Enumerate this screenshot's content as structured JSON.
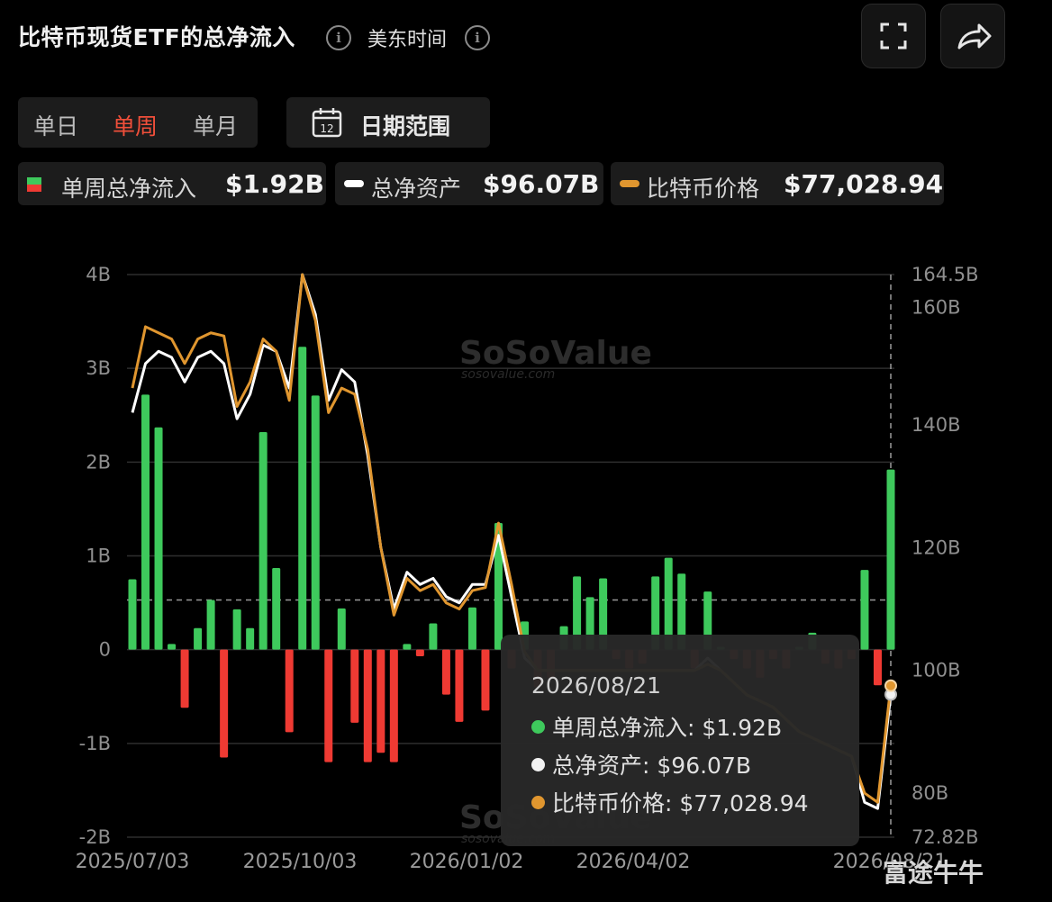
{
  "header": {
    "title": "比特币现货ETF的总净流入",
    "timezone": "美东时间"
  },
  "period_tabs": [
    {
      "label": "单日",
      "active": false
    },
    {
      "label": "单周",
      "active": true
    },
    {
      "label": "单月",
      "active": false
    }
  ],
  "date_range": {
    "label": "日期范围",
    "calendar_day": "12"
  },
  "legend": [
    {
      "label": "单周总净流入",
      "value": "$1.92B"
    },
    {
      "label": "总净资产",
      "value": "$96.07B"
    },
    {
      "label": "比特币价格",
      "value": "$77,028.94"
    }
  ],
  "tooltip": {
    "date": "2026/08/21",
    "rows": [
      {
        "label": "单周总净流入:",
        "value": "$1.92B",
        "color": "#3ec95c"
      },
      {
        "label": "总净资产:",
        "value": "$96.07B",
        "color": "#f2f2f2"
      },
      {
        "label": "比特币价格:",
        "value": "$77,028.94",
        "color": "#e0962f"
      }
    ]
  },
  "watermark": {
    "name": "SoSoValue",
    "url": "sosovalue.com"
  },
  "brand": "富途牛牛",
  "colors": {
    "inflow": "#3ec95c",
    "outflow": "#ef3a33",
    "assets": "#ffffff",
    "price": "#e0962f"
  },
  "chart_data": {
    "type": "bar",
    "ylim": [
      -2,
      4
    ],
    "y2lim": [
      72.82,
      164.5
    ],
    "left_ticks": [
      "-2B",
      "-1B",
      "0",
      "1B",
      "2B",
      "3B",
      "4B"
    ],
    "right_ticks": [
      "72.82B",
      "80B",
      "100B",
      "120B",
      "140B",
      "160B",
      "164.5B"
    ],
    "x_ticks": [
      "2025/07/03",
      "2025/10/03",
      "2026/01/02",
      "2026/04/02",
      "2026/08/21"
    ],
    "reference_line": 0.53,
    "series": [
      {
        "name": "单周总净流入",
        "values": [
          0.75,
          2.72,
          2.37,
          0.06,
          -0.62,
          0.23,
          0.53,
          -1.15,
          0.43,
          0.23,
          2.32,
          0.87,
          -0.88,
          3.23,
          2.71,
          -1.2,
          0.44,
          -0.78,
          -1.2,
          -1.1,
          -1.2,
          0.06,
          -0.07,
          0.28,
          -0.48,
          -0.77,
          0.45,
          -0.65,
          1.35,
          -0.2,
          0.3,
          -0.4,
          -0.3,
          0.25,
          0.78,
          0.56,
          0.76,
          -0.1,
          -0.2,
          -0.15,
          0.78,
          0.98,
          0.81,
          -0.2,
          0.62,
          0.03,
          -0.1,
          -0.2,
          -0.3,
          -0.1,
          -0.2,
          0.03,
          0.18,
          -0.15,
          -0.2,
          -0.1,
          0.85,
          -0.38,
          1.92
        ]
      },
      {
        "name": "总净资产",
        "values": [
          142,
          150,
          152,
          151,
          147,
          151,
          152,
          150,
          141,
          145,
          153,
          152,
          146,
          164.5,
          158,
          144,
          149,
          147,
          135,
          120,
          110,
          116,
          114,
          115,
          112,
          111,
          114,
          114,
          122,
          112,
          102,
          100,
          100,
          100,
          100,
          100,
          100,
          100,
          100,
          100,
          100,
          100,
          100,
          100,
          102,
          100,
          98,
          96,
          95,
          94,
          92,
          90,
          89,
          88,
          87,
          86,
          78.5,
          77.5,
          96.07
        ]
      },
      {
        "name": "比特币价格",
        "values": [
          146,
          156,
          155,
          154,
          150,
          154,
          155,
          154.5,
          143,
          147,
          154,
          152,
          144,
          164.5,
          157,
          142,
          146,
          145,
          136,
          120,
          109,
          115,
          113,
          114,
          111,
          110,
          113,
          113.5,
          124,
          114,
          103,
          100,
          100,
          100,
          100,
          100,
          100,
          100,
          100,
          100,
          100,
          100,
          100,
          100,
          101,
          100,
          98,
          96,
          95,
          94,
          92,
          90,
          89,
          88,
          87,
          86,
          80,
          78.5,
          97.5
        ]
      }
    ]
  }
}
